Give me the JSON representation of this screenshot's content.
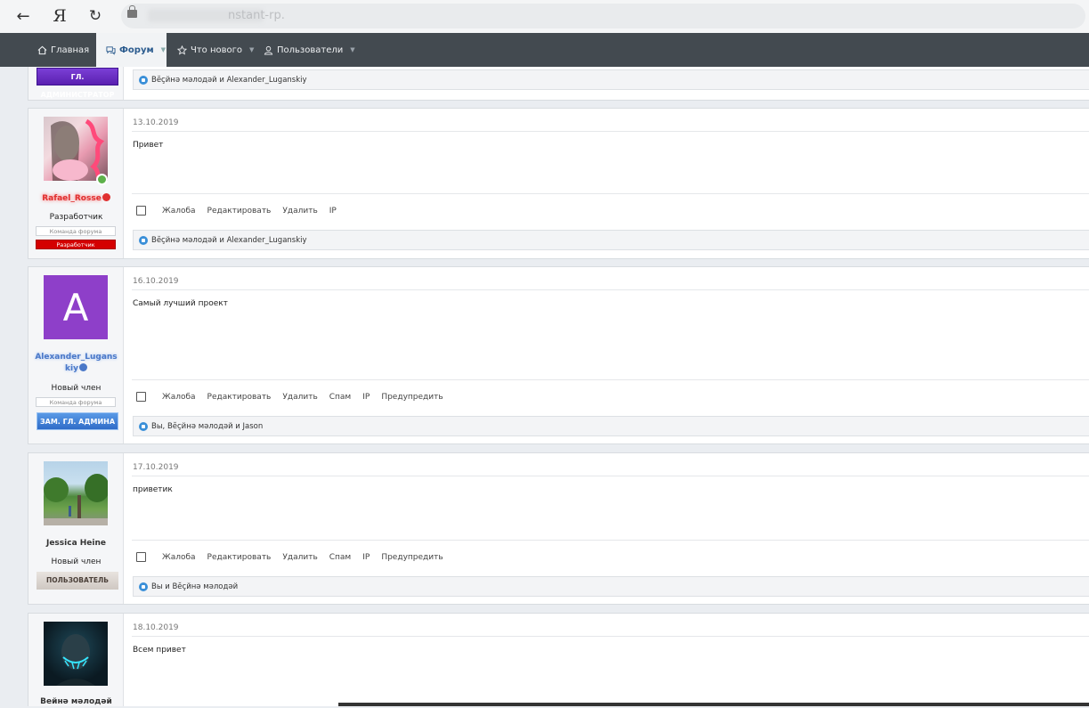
{
  "browser": {
    "back_icon": "←",
    "ya_logo": "Я",
    "reload_icon": "↻",
    "url": "nstant-rp."
  },
  "nav": {
    "home": "Главная",
    "forum": "Форум",
    "whats_new": "Что нового",
    "users": "Пользователи"
  },
  "top_partial": {
    "banner": "ГЛ. АДМИНИСТРАТОР",
    "likes": "Βĕçйнә мәлодәй и Alexander_Luganskiy"
  },
  "posts": [
    {
      "username": "Rafael_Rosse",
      "user_title": "Разработчик",
      "team": "Команда форума",
      "banner": "Разработчик",
      "date": "13.10.2019",
      "message": "Привет",
      "actions": [
        "Жалоба",
        "Редактировать",
        "Удалить",
        "IP"
      ],
      "likes": "Βĕçйнә мәлодәй и Alexander_Luganskiy"
    },
    {
      "username_line1": "Alexander_Lugans",
      "username_line2": "kiy",
      "avatar_letter": "A",
      "user_title": "Новый член",
      "team": "Команда форума",
      "banner": "ЗАМ. ГЛ. АДМИНА",
      "date": "16.10.2019",
      "message": "Самый лучший проект",
      "actions": [
        "Жалоба",
        "Редактировать",
        "Удалить",
        "Спам",
        "IP",
        "Предупредить"
      ],
      "likes": "Вы, Βĕçйнә мәлодәй и Jason"
    },
    {
      "username": "Jessica Heine",
      "user_title": "Новый член",
      "banner": "ПОЛЬЗОВАТЕЛЬ",
      "date": "17.10.2019",
      "message": "приветик",
      "actions": [
        "Жалоба",
        "Редактировать",
        "Удалить",
        "Спам",
        "IP",
        "Предупредить"
      ],
      "likes": "Вы и Βĕçйнә мәлодәй"
    },
    {
      "username": "Βейнә мәлодәй",
      "date": "18.10.2019",
      "message": "Всем привет"
    }
  ],
  "colors": {
    "nav_bg": "#434a50",
    "admin_banner": "#6a2cc0",
    "dev_banner": "#cc0000",
    "zam_banner": "#3d7ed8",
    "rafael_name": "#e03030",
    "alexander_name": "#4a78c8",
    "like_blue": "#3a8fd8"
  }
}
